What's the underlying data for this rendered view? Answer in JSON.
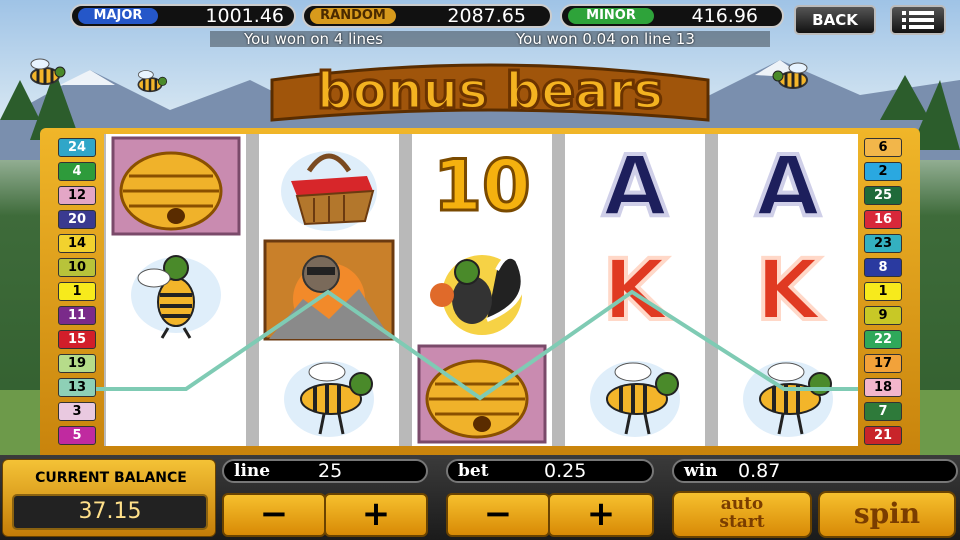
{
  "jackpots": {
    "major": {
      "label": "MAJOR",
      "value": "1001.46",
      "color": "#2557c9"
    },
    "random": {
      "label": "RANDOM",
      "value": "2087.65",
      "color": "#d79a1c"
    },
    "minor": {
      "label": "MINOR",
      "value": "416.96",
      "color": "#2ea33a"
    }
  },
  "buttons": {
    "back": "BACK",
    "menu_icon": "hamburger-menu-icon",
    "auto_start": "auto start",
    "spin": "spin",
    "minus": "−",
    "plus": "+"
  },
  "messages": {
    "left": "You won on 4 lines",
    "right": "You won 0.04 on line 13"
  },
  "title": "bonus bears",
  "left_lines": [
    "24",
    "4",
    "12",
    "20",
    "14",
    "10",
    "1",
    "11",
    "15",
    "19",
    "13",
    "3",
    "5"
  ],
  "right_lines": [
    "6",
    "2",
    "25",
    "16",
    "23",
    "8",
    "1",
    "9",
    "22",
    "17",
    "18",
    "7",
    "21"
  ],
  "reels": [
    [
      "beehive",
      "bee",
      "empty"
    ],
    [
      "picnic-basket",
      "bear-mountain",
      "bee"
    ],
    [
      "10",
      "skunk",
      "beehive"
    ],
    [
      "A",
      "K",
      "bee"
    ],
    [
      "A",
      "K",
      "bee"
    ]
  ],
  "balance": {
    "label": "CURRENT BALANCE",
    "value": "37.15"
  },
  "line": {
    "label": "line",
    "value": "25"
  },
  "bet": {
    "label": "bet",
    "value": "0.25"
  },
  "win": {
    "label": "win",
    "value": "0.87"
  },
  "colors": {
    "frame": "#f0b629",
    "win_line": "#7fcbb4"
  }
}
